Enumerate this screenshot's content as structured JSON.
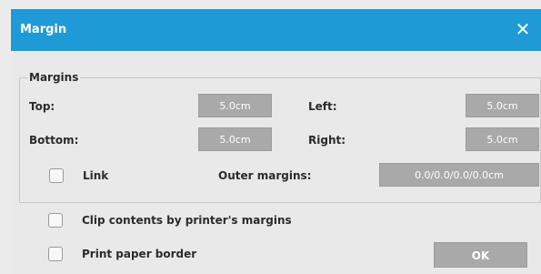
{
  "dialog": {
    "title": "Margin",
    "close_glyph": "✕"
  },
  "margins_group": {
    "label": "Margins",
    "top_label": "Top:",
    "top_value": "5.0cm",
    "left_label": "Left:",
    "left_value": "5.0cm",
    "bottom_label": "Bottom:",
    "bottom_value": "5.0cm",
    "right_label": "Right:",
    "right_value": "5.0cm",
    "link_label": "Link",
    "outer_margins_label": "Outer margins:",
    "outer_margins_value": "0.0/0.0/0.0/0.0cm"
  },
  "options": {
    "clip_label": "Clip contents by printer's margins",
    "print_border_label": "Print paper border"
  },
  "buttons": {
    "ok_label": "OK"
  },
  "colors": {
    "titlebar": "#1e9ad7",
    "field_bg": "#a9a9a9",
    "dialog_bg": "#e9e9e9"
  }
}
